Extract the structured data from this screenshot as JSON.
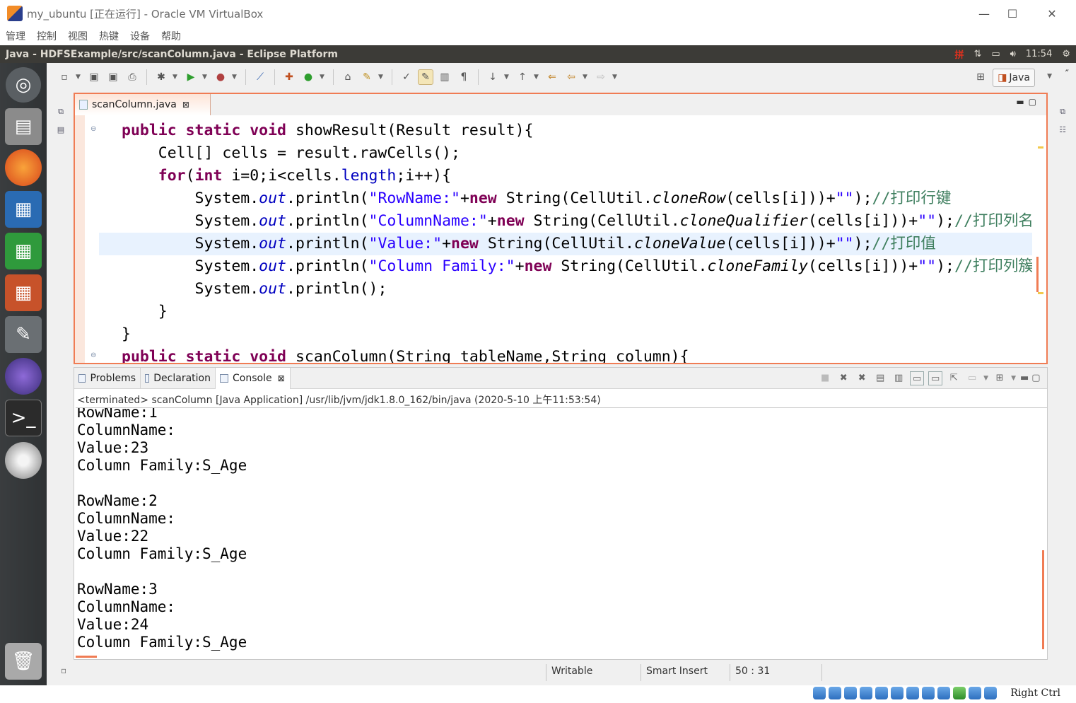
{
  "vbox": {
    "title": "my_ubuntu [正在运行] - Oracle VM VirtualBox",
    "menu": [
      "管理",
      "控制",
      "视图",
      "热键",
      "设备",
      "帮助"
    ],
    "host_key_label": "Right Ctrl"
  },
  "ubuntu_panel": {
    "window_title": "Java - HDFSExample/src/scanColumn.java - Eclipse Platform",
    "ime": "拼",
    "time": "11:54"
  },
  "eclipse": {
    "perspective_label": "Java",
    "editor_tab": "scanColumn.java",
    "code_lines": [
      [
        [
          "",
          "public static void "
        ],
        [
          "n",
          "showResult(Result result){"
        ]
      ],
      [
        [
          "n",
          "    Cell[] cells = result.rawCells();"
        ]
      ],
      [
        [
          "k",
          "    for"
        ],
        [
          "n",
          "("
        ],
        [
          "k",
          "int"
        ],
        [
          "n",
          " i=0;i<cells."
        ],
        [
          "f2",
          "length"
        ],
        [
          "n",
          ";i++){"
        ]
      ],
      [
        [
          "n",
          "        System."
        ],
        [
          "f",
          "out"
        ],
        [
          "n",
          ".println("
        ],
        [
          "s",
          "\"RowName:\""
        ],
        [
          "n",
          "+"
        ],
        [
          "k",
          "new"
        ],
        [
          "n",
          " String(CellUtil."
        ],
        [
          "i",
          "cloneRow"
        ],
        [
          "n",
          "(cells[i]))+"
        ],
        [
          "s",
          "\"\""
        ],
        [
          "n",
          ");"
        ],
        [
          "c",
          "//打印行键"
        ]
      ],
      [
        [
          "n",
          "        System."
        ],
        [
          "f",
          "out"
        ],
        [
          "n",
          ".println("
        ],
        [
          "s",
          "\"ColumnName:\""
        ],
        [
          "n",
          "+"
        ],
        [
          "k",
          "new"
        ],
        [
          "n",
          " String(CellUtil."
        ],
        [
          "i",
          "cloneQualifier"
        ],
        [
          "n",
          "(cells[i]))+"
        ],
        [
          "s",
          "\"\""
        ],
        [
          "n",
          ");"
        ],
        [
          "c",
          "//打印列名"
        ]
      ],
      [
        [
          "n",
          "        System."
        ],
        [
          "f",
          "out"
        ],
        [
          "n",
          ".println("
        ],
        [
          "s",
          "\"Value:\""
        ],
        [
          "n",
          "+"
        ],
        [
          "k",
          "new"
        ],
        [
          "n",
          " String(CellUtil."
        ],
        [
          "i",
          "cloneValue"
        ],
        [
          "n",
          "(cells[i]))+"
        ],
        [
          "s",
          "\"\""
        ],
        [
          "n",
          ");"
        ],
        [
          "c",
          "//打印值"
        ]
      ],
      [
        [
          "n",
          "        System."
        ],
        [
          "f",
          "out"
        ],
        [
          "n",
          ".println("
        ],
        [
          "s",
          "\"Column Family:\""
        ],
        [
          "n",
          "+"
        ],
        [
          "k",
          "new"
        ],
        [
          "n",
          " String(CellUtil."
        ],
        [
          "i",
          "cloneFamily"
        ],
        [
          "n",
          "(cells[i]))+"
        ],
        [
          "s",
          "\"\""
        ],
        [
          "n",
          ");"
        ],
        [
          "c",
          "//打印列簇"
        ]
      ],
      [
        [
          "n",
          "        System."
        ],
        [
          "f",
          "out"
        ],
        [
          "n",
          ".println();"
        ]
      ],
      [
        [
          "n",
          "    }"
        ]
      ],
      [
        [
          "n",
          "}"
        ]
      ],
      [
        [
          "k",
          "public static void "
        ],
        [
          "n",
          "scanColumn(String tableName,String column){"
        ]
      ]
    ],
    "console": {
      "tabs": [
        "Problems",
        "Declaration",
        "Console"
      ],
      "info": "<terminated> scanColumn [Java Application] /usr/lib/jvm/jdk1.8.0_162/bin/java (2020-5-10 上午11:53:54)",
      "output": [
        "RowName:1",
        "ColumnName:",
        "Value:23",
        "Column Family:S_Age",
        "",
        "RowName:2",
        "ColumnName:",
        "Value:22",
        "Column Family:S_Age",
        "",
        "RowName:3",
        "ColumnName:",
        "Value:24",
        "Column Family:S_Age"
      ]
    },
    "status": {
      "writable": "Writable",
      "insert_mode": "Smart Insert",
      "position": "50 : 31"
    }
  },
  "launcher_items": [
    "ubuntu-dash",
    "files",
    "firefox",
    "writer",
    "calc",
    "impress",
    "system-settings",
    "eclipse",
    "terminal",
    "dvd",
    "trash"
  ]
}
